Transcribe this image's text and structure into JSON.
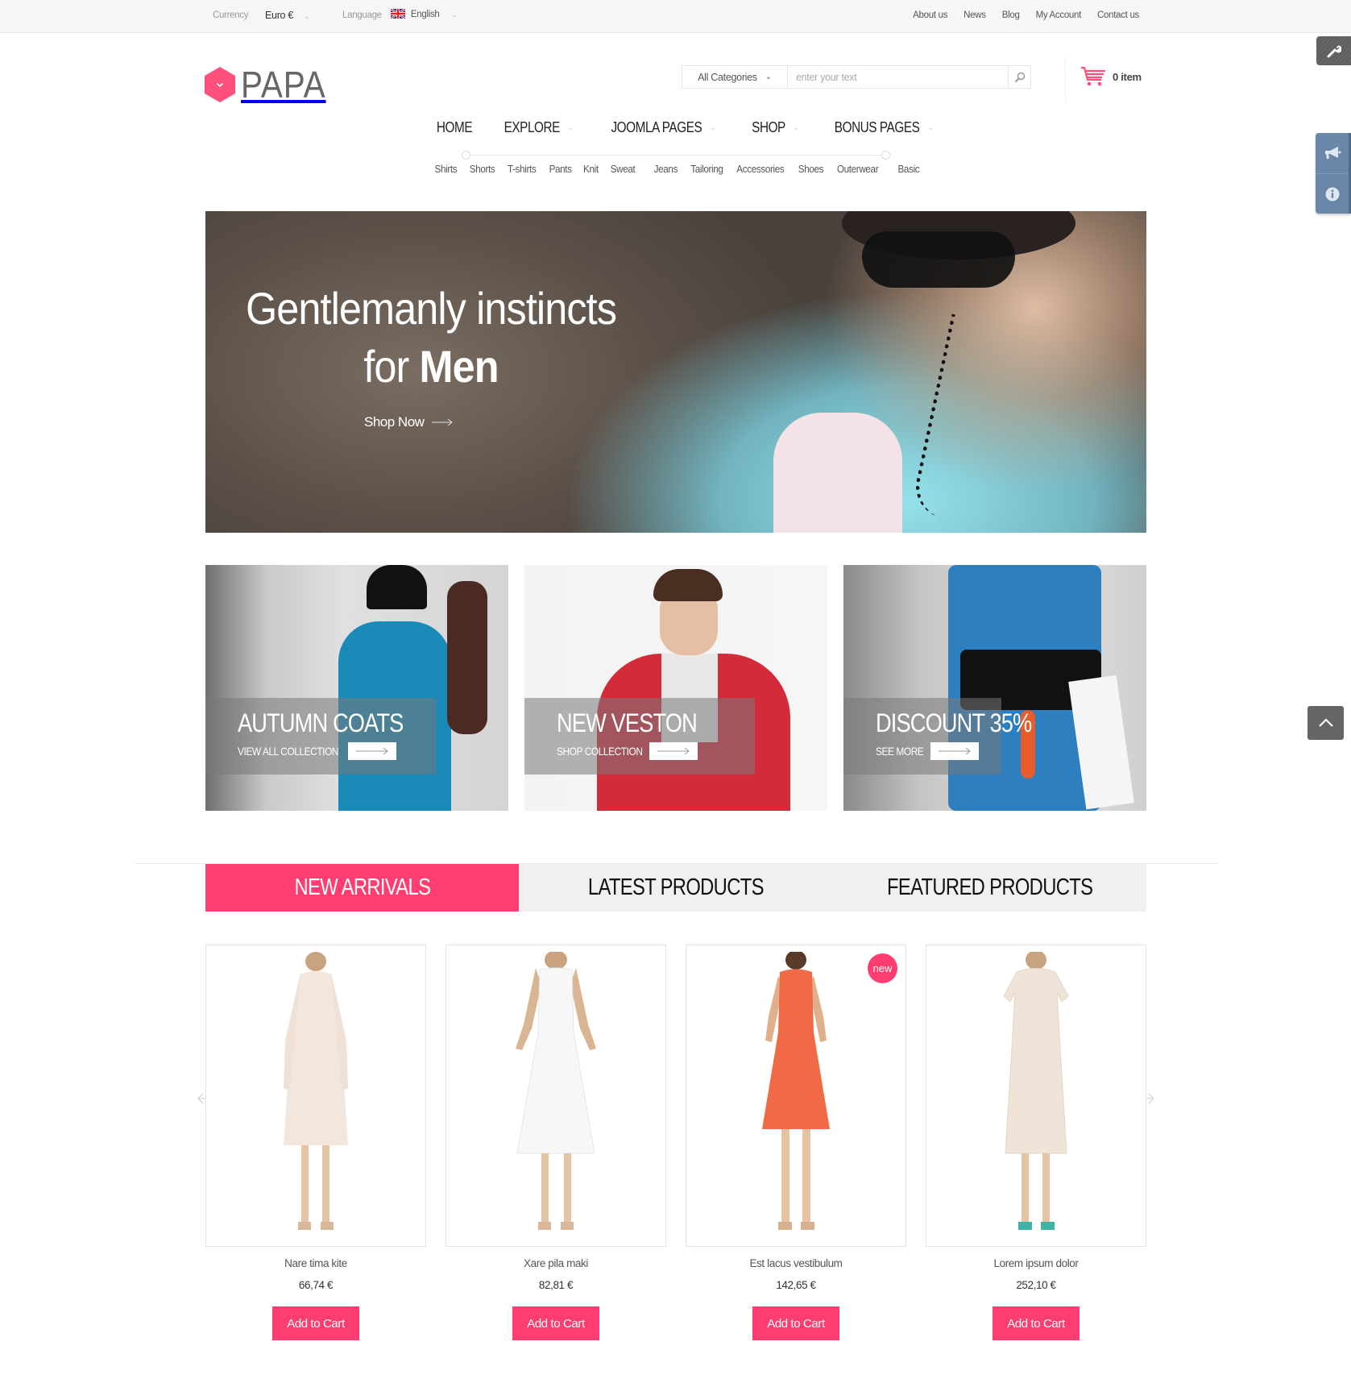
{
  "topbar": {
    "currency_label": "Currency",
    "currency_value": "Euro €",
    "language_label": "Language",
    "language_value": "English",
    "links": [
      "About us",
      "News",
      "Blog",
      "My Account",
      "Contact us"
    ]
  },
  "header": {
    "logo_text": "PAPA",
    "search": {
      "category": "All Categories",
      "placeholder": "enter your text"
    },
    "cart": {
      "count_label": "0 item"
    }
  },
  "nav": {
    "main": [
      {
        "label": "HOME",
        "has_dropdown": false
      },
      {
        "label": "EXPLORE",
        "has_dropdown": true
      },
      {
        "label": "JOOMLA PAGES",
        "has_dropdown": true
      },
      {
        "label": "SHOP",
        "has_dropdown": true
      },
      {
        "label": "BONUS PAGES",
        "has_dropdown": true
      }
    ],
    "sub": [
      "Shirts",
      "Shorts",
      "T-shirts",
      "Pants",
      "Knit",
      "Sweat",
      "Jeans",
      "Tailoring",
      "Accessories",
      "Shoes",
      "Outerwear",
      "Basic"
    ]
  },
  "hero": {
    "line1": "Gentlemanly instincts",
    "line2_light": "for",
    "line2_bold": "Men",
    "cta": "Shop Now"
  },
  "tiles": [
    {
      "title": "AUTUMN COATS",
      "link": "VIEW ALL COLLECTION"
    },
    {
      "title": "NEW VESTON",
      "link": "SHOP COLLECTION"
    },
    {
      "title": "DISCOUNT 35%",
      "link": "SEE MORE"
    }
  ],
  "tabs": [
    {
      "label": "NEW ARRIVALS",
      "active": true
    },
    {
      "label": "LATEST PRODUCTS",
      "active": false
    },
    {
      "label": "FEATURED PRODUCTS",
      "active": false
    }
  ],
  "products": [
    {
      "name": "Nare tima kite",
      "price": "66,74 €",
      "button": "Add to Cart",
      "badge": ""
    },
    {
      "name": "Xare pila maki",
      "price": "82,81 €",
      "button": "Add to Cart",
      "badge": ""
    },
    {
      "name": "Est lacus vestibulum",
      "price": "142,65 €",
      "button": "Add to Cart",
      "badge": "new"
    },
    {
      "name": "Lorem ipsum dolor",
      "price": "252,10 €",
      "button": "Add to Cart",
      "badge": ""
    }
  ],
  "colors": {
    "accent": "#ff3d70",
    "topbar_bg": "#f6f6f6",
    "tab_bg": "#f0f0f0",
    "side_panel": "#6a86a8",
    "back_top": "#666666"
  }
}
